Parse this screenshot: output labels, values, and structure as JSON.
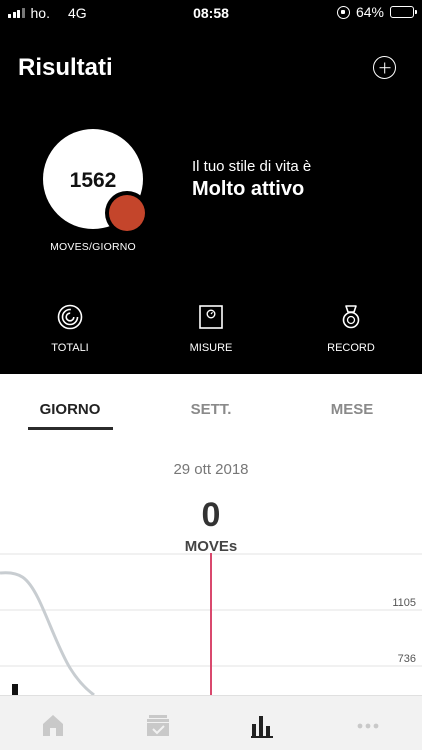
{
  "status_bar": {
    "carrier": "ho.",
    "network": "4G",
    "time": "08:58",
    "battery_percent": "64%",
    "battery_level": 0.64,
    "battery_color": "#f5c400"
  },
  "header": {
    "title": "Risultati",
    "add_icon": "plus-circle-icon"
  },
  "summary": {
    "moves_per_day": "1562",
    "moves_label": "MOVES/GIORNO",
    "lifestyle_intro": "Il tuo stile di vita è",
    "lifestyle_value": "Molto attivo",
    "accent_color": "#c4452b"
  },
  "sections": [
    {
      "label": "TOTALI",
      "icon": "rings-icon"
    },
    {
      "label": "MISURE",
      "icon": "scale-icon"
    },
    {
      "label": "RECORD",
      "icon": "medal-icon"
    }
  ],
  "tabs": [
    {
      "label": "GIORNO",
      "active": true
    },
    {
      "label": "SETT.",
      "active": false
    },
    {
      "label": "MESE",
      "active": false
    }
  ],
  "day": {
    "date": "29 ott 2018",
    "moves": "0",
    "unit": "MOVEs"
  },
  "chart_data": {
    "type": "line",
    "y_ticks": [
      "1105",
      "736"
    ],
    "cursor_color": "#d9486d",
    "line_color": "#c8cdd1"
  },
  "bottom_nav": [
    {
      "icon": "home-icon",
      "active": false
    },
    {
      "icon": "inbox-check-icon",
      "active": false
    },
    {
      "icon": "bar-chart-icon",
      "active": true
    },
    {
      "icon": "more-dots-icon",
      "active": false
    }
  ]
}
